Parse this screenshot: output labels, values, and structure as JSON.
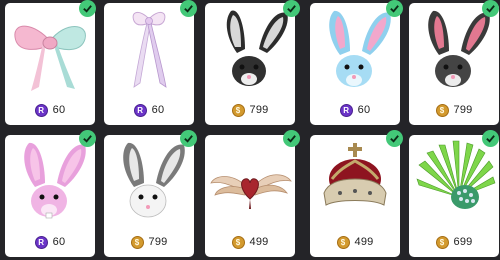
{
  "currency_icons": {
    "robux": "purple-coin-icon",
    "coins": "gold-coin-icon"
  },
  "colors": {
    "accent_check": "#43c878",
    "robux": "#6b34c8",
    "coins": "#d39a2e"
  },
  "items": [
    {
      "name": "Pastel Bow",
      "currency": "robux",
      "price": "60",
      "owned": true
    },
    {
      "name": "Lilac Ribbon Bow",
      "currency": "robux",
      "price": "60",
      "owned": true
    },
    {
      "name": "Black Striped Bunny Ears",
      "currency": "coins",
      "price": "799",
      "owned": true
    },
    {
      "name": "Sky Bunny Head",
      "currency": "robux",
      "price": "60",
      "owned": true
    },
    {
      "name": "Dark Bunny Head",
      "currency": "coins",
      "price": "799",
      "owned": true
    },
    {
      "name": "Pink Bunny Head",
      "currency": "robux",
      "price": "60",
      "owned": true
    },
    {
      "name": "White Bunny Head",
      "currency": "coins",
      "price": "799",
      "owned": true
    },
    {
      "name": "Winged Heart",
      "currency": "coins",
      "price": "499",
      "owned": true
    },
    {
      "name": "Royal Crown",
      "currency": "coins",
      "price": "499",
      "owned": true
    },
    {
      "name": "Emerald Feather Fan",
      "currency": "coins",
      "price": "699",
      "owned": true
    }
  ]
}
